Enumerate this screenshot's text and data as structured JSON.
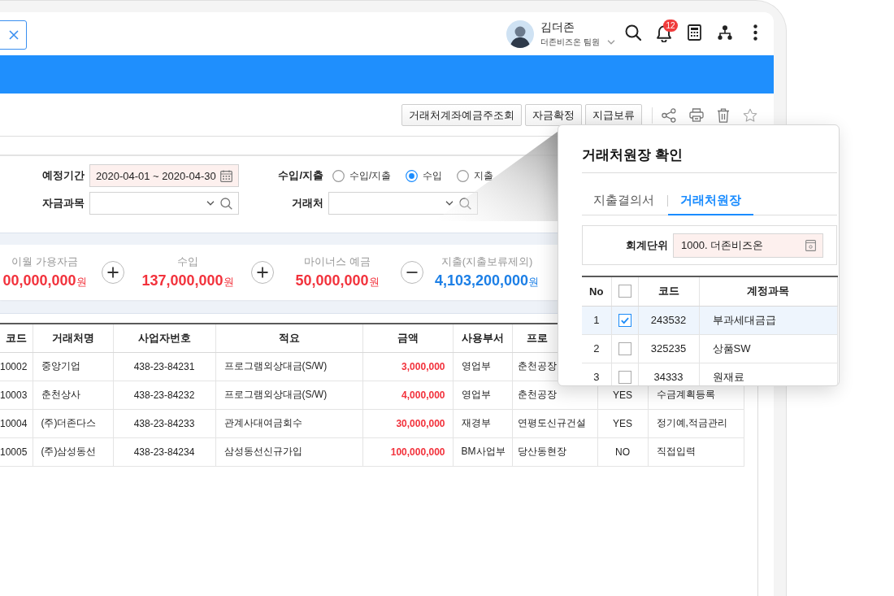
{
  "header": {
    "user": {
      "name": "김더존",
      "role": "더존비즈온 팀원"
    },
    "notification_count": "12"
  },
  "toolbar": {
    "buttons": [
      "거래처계좌예금주조회",
      "자금확정",
      "지급보류"
    ]
  },
  "filters": {
    "period": {
      "label": "예정기간",
      "value": "2020-04-01 ~ 2020-04-30"
    },
    "flow": {
      "label": "수입/지출",
      "options": [
        {
          "label": "수입/지출",
          "selected": false
        },
        {
          "label": "수입",
          "selected": true
        },
        {
          "label": "지출",
          "selected": false
        }
      ]
    },
    "fund_item": {
      "label": "자금과목"
    },
    "partner": {
      "label": "거래처"
    }
  },
  "summary": [
    {
      "kind": "figure",
      "label": "이월 가용자금",
      "amount": "00,000,000",
      "unit": "원",
      "color": "#f2323c"
    },
    {
      "kind": "plus"
    },
    {
      "kind": "figure",
      "label": "수입",
      "amount": "137,000,000",
      "unit": "원",
      "color": "#f2323c"
    },
    {
      "kind": "plus"
    },
    {
      "kind": "figure",
      "label": "마이너스 예금",
      "amount": "50,000,000",
      "unit": "원",
      "color": "#f2323c"
    },
    {
      "kind": "minus"
    },
    {
      "kind": "figure",
      "label": "지출(지출보류제외)",
      "amount": "4,103,200,000",
      "unit": "원",
      "color": "#1c7fe6"
    }
  ],
  "table": {
    "columns": [
      "코드",
      "거래처명",
      "사업자번호",
      "적요",
      "금액",
      "사용부서",
      "프로"
    ],
    "rows": [
      [
        "10002",
        "중앙기업",
        "438-23-84231",
        "프로그램외상대금(S/W)",
        "3,000,000",
        "영업부",
        "춘천공장"
      ],
      [
        "10003",
        "춘천상사",
        "438-23-84232",
        "프로그램외상대금(S/W)",
        "4,000,000",
        "영업부",
        "춘천공장",
        "YES",
        "수금계획등록"
      ],
      [
        "10004",
        "(주)더존다스",
        "438-23-84233",
        "관계사대여금회수",
        "30,000,000",
        "재경부",
        "연평도신규건설",
        "YES",
        "정기예,적금관리"
      ],
      [
        "10005",
        "(주)삼성동선",
        "438-23-84234",
        "삼성동선신규가입",
        "100,000,000",
        "BM사업부",
        "당산동현장",
        "NO",
        "직접입력"
      ]
    ]
  },
  "ledger_dialog": {
    "title": "거래처원장 확인",
    "tabs": [
      {
        "label": "지출결의서",
        "selected": false
      },
      {
        "label": "거래처원장",
        "selected": true
      }
    ],
    "unit": {
      "label": "회계단위",
      "value": "1000. 더존비즈온"
    },
    "table": {
      "columns": [
        "No",
        "코드",
        "계정과목"
      ],
      "all_checked": false,
      "rows": [
        {
          "no": "1",
          "checked": true,
          "selected": true,
          "code": "243532",
          "account": "부과세대금급"
        },
        {
          "no": "2",
          "checked": false,
          "selected": false,
          "code": "325235",
          "account": "상품SW"
        },
        {
          "no": "3",
          "checked": false,
          "selected": false,
          "code": "34333",
          "account": "원재료"
        }
      ]
    }
  }
}
